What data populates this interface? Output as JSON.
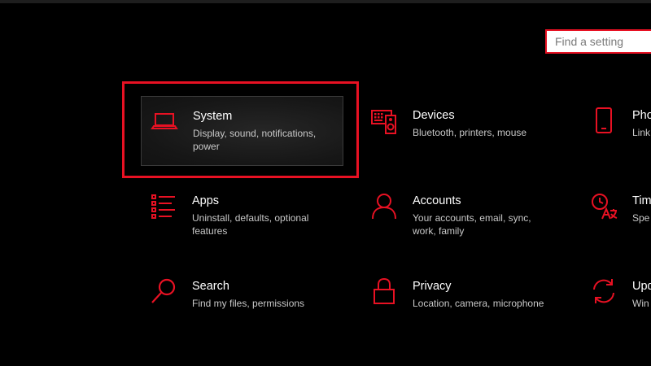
{
  "search": {
    "placeholder": "Find a setting"
  },
  "accent_color": "#e81123",
  "tiles": [
    {
      "title": "System",
      "desc": "Display, sound, notifications, power",
      "icon": "laptop-icon"
    },
    {
      "title": "Devices",
      "desc": "Bluetooth, printers, mouse",
      "icon": "keyboard-speaker-icon"
    },
    {
      "title": "Pho",
      "desc": "Link",
      "icon": "phone-icon"
    },
    {
      "title": "Apps",
      "desc": "Uninstall, defaults, optional features",
      "icon": "list-icon"
    },
    {
      "title": "Accounts",
      "desc": "Your accounts, email, sync, work, family",
      "icon": "person-icon"
    },
    {
      "title": "Tim",
      "desc": "Spe",
      "icon": "time-language-icon"
    },
    {
      "title": "Search",
      "desc": "Find my files, permissions",
      "icon": "search-icon"
    },
    {
      "title": "Privacy",
      "desc": "Location, camera, microphone",
      "icon": "lock-icon"
    },
    {
      "title": "Upd",
      "desc": "Win back",
      "icon": "refresh-icon"
    }
  ]
}
